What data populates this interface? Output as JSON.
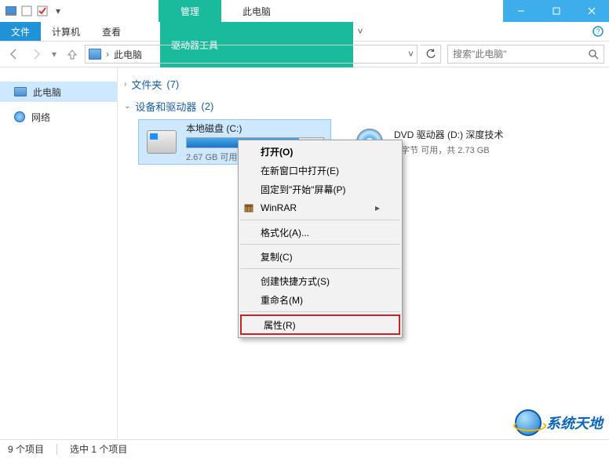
{
  "titlebar": {
    "context_tab": "管理",
    "title": "此电脑"
  },
  "ribbon": {
    "file": "文件",
    "computer": "计算机",
    "view": "查看",
    "drive_tools": "驱动器工具"
  },
  "nav": {
    "breadcrumb": "此电脑",
    "search_placeholder": "搜索\"此电脑\""
  },
  "sidebar": {
    "items": [
      {
        "label": "此电脑"
      },
      {
        "label": "网络"
      }
    ]
  },
  "groups": {
    "folders": {
      "label": "文件夹",
      "count": "(7)"
    },
    "devices": {
      "label": "设备和驱动器",
      "count": "(2)"
    }
  },
  "drives": [
    {
      "name": "本地磁盘 (C:)",
      "sub": "2.67 GB 可用"
    },
    {
      "name": "DVD 驱动器 (D:) 深度技术",
      "sub": "0 字节 可用，共 2.73 GB"
    }
  ],
  "context_menu": {
    "open": "打开(O)",
    "open_new": "在新窗口中打开(E)",
    "pin_start": "固定到\"开始\"屏幕(P)",
    "winrar": "WinRAR",
    "format": "格式化(A)...",
    "copy": "复制(C)",
    "shortcut": "创建快捷方式(S)",
    "rename": "重命名(M)",
    "properties": "属性(R)"
  },
  "statusbar": {
    "count": "9 个项目",
    "selected": "选中 1 个项目"
  },
  "watermark": "系统天地"
}
